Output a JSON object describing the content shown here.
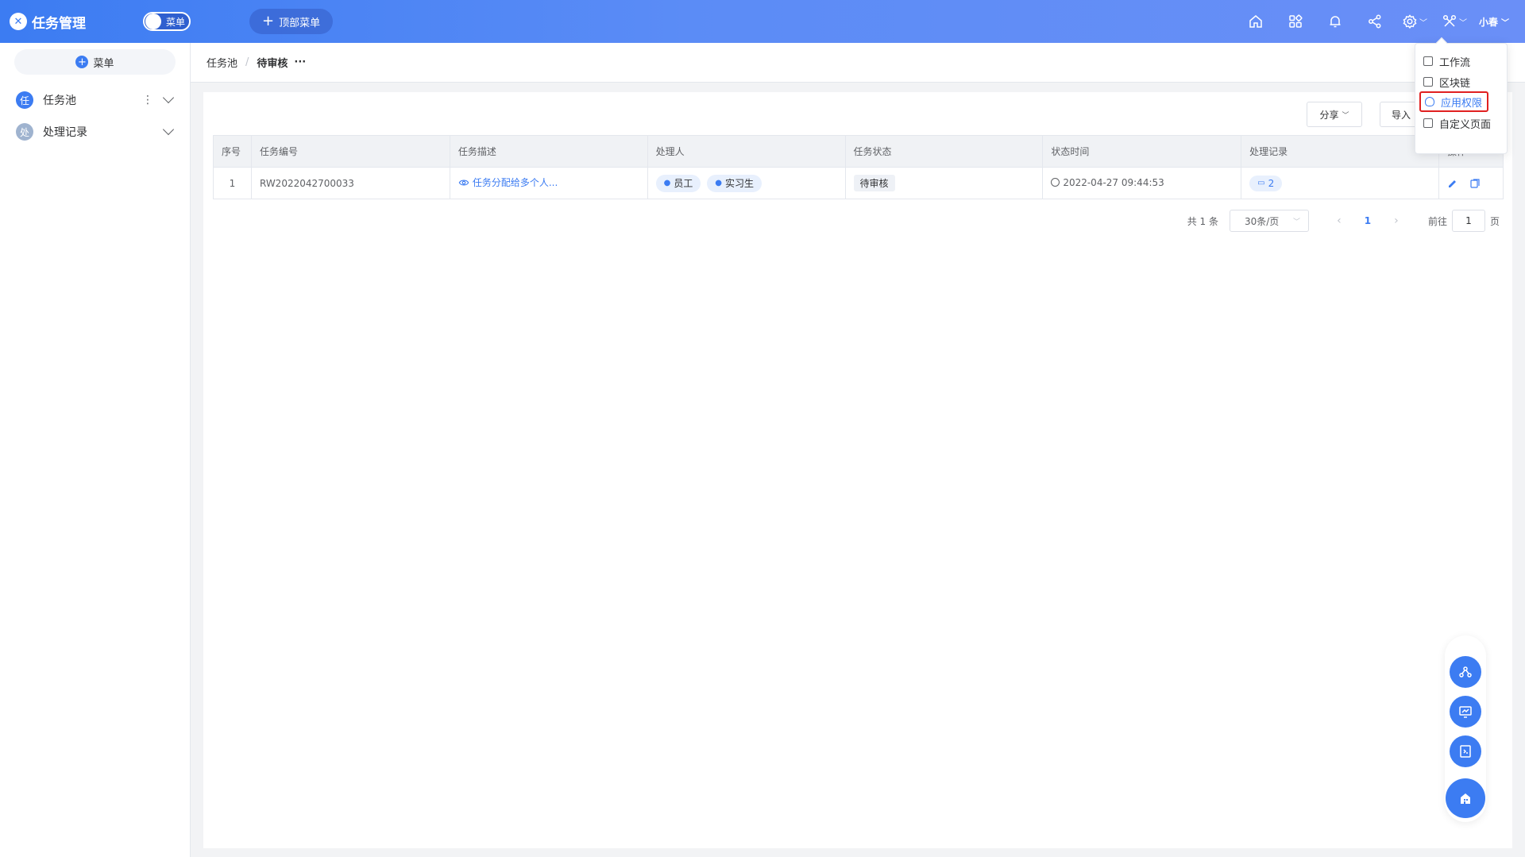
{
  "header": {
    "app_name": "任务管理",
    "logo_char": "✕",
    "toggle_label": "菜单",
    "top_menu_label": "顶部菜单",
    "user_name": "小春",
    "icons": [
      "home-icon",
      "apps-icon",
      "bell-icon",
      "share-icon",
      "settings-icon",
      "tools-icon"
    ]
  },
  "sidebar": {
    "menu_label": "菜单",
    "items": [
      {
        "avatar": "任",
        "label": "任务池",
        "color": "#3c7cf2"
      },
      {
        "avatar": "处",
        "label": "处理记录",
        "color": "#9fb3cf"
      }
    ]
  },
  "breadcrumb": {
    "items": [
      "任务池",
      "待审核"
    ],
    "separator": "/",
    "more": "···"
  },
  "toolbar": {
    "share_label": "分享",
    "import_label": "导入"
  },
  "table": {
    "columns": [
      "序号",
      "任务编号",
      "任务描述",
      "处理人",
      "任务状态",
      "状态时间",
      "处理记录",
      "操作"
    ],
    "rows": [
      {
        "index": "1",
        "task_no": "RW2022042700033",
        "desc": "任务分配给多个人...",
        "handlers": [
          "员工",
          "实习生"
        ],
        "status": "待审核",
        "time": "2022-04-27 09:44:53",
        "records": "2"
      }
    ]
  },
  "pagination": {
    "total_text": "共 1 条",
    "page_size": "30条/页",
    "current_page": "1",
    "goto_label": "前往",
    "goto_value": "1",
    "page_suffix": "页"
  },
  "dropdown": {
    "items": [
      "工作流",
      "区块链",
      "应用权限",
      "自定义页面"
    ],
    "active": "应用权限"
  },
  "colors": {
    "primary": "#3c7cf2",
    "highlight_border": "#e02020"
  }
}
